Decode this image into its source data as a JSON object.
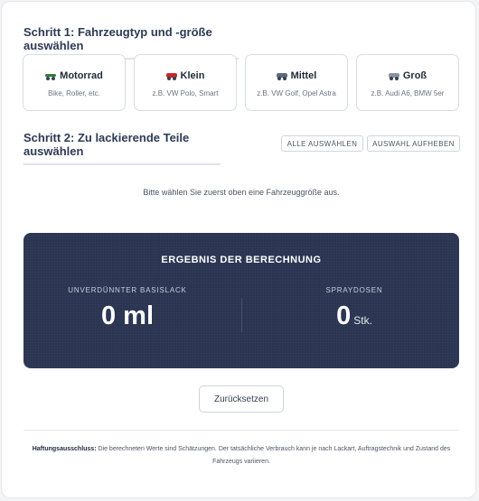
{
  "step1": {
    "title": "Schritt 1: Fahrzeugtyp und -größe auswählen",
    "vehicles": [
      {
        "label": "Motorrad",
        "sub": "Bike, Roller, etc.",
        "icon": "motorcycle-icon",
        "color": "#2e7d32"
      },
      {
        "label": "Klein",
        "sub": "z.B. VW Polo, Smart",
        "icon": "small-car-icon",
        "color": "#c62828"
      },
      {
        "label": "Mittel",
        "sub": "z.B. VW Golf, Opel Astra",
        "icon": "medium-car-icon",
        "color": "#5f6b7a"
      },
      {
        "label": "Groß",
        "sub": "z.B. Audi A6, BMW 5er",
        "icon": "large-car-icon",
        "color": "#8a93a0"
      }
    ]
  },
  "step2": {
    "title": "Schritt 2: Zu lackierende Teile auswählen",
    "select_all": "ALLE AUSWÄHLEN",
    "deselect_all": "AUSWAHL AUFHEBEN",
    "info": "Bitte wählen Sie zuerst oben eine Fahrzeuggröße aus."
  },
  "result": {
    "title": "ERGEBNIS DER BERECHNUNG",
    "basecoat_label": "UNVERDÜNNTER BASISLACK",
    "basecoat_value": "0 ml",
    "spray_label": "SPRAYDOSEN",
    "spray_value": "0",
    "spray_unit": "Stk."
  },
  "reset_label": "Zurücksetzen",
  "disclaimer": {
    "label": "Haftungsausschluss:",
    "text": " Die berechneten Werte sind Schätzungen. Der tatsächliche Verbrauch kann je nach Lackart, Auftragstechnik und Zustand des Fahrzeugs variieren."
  }
}
